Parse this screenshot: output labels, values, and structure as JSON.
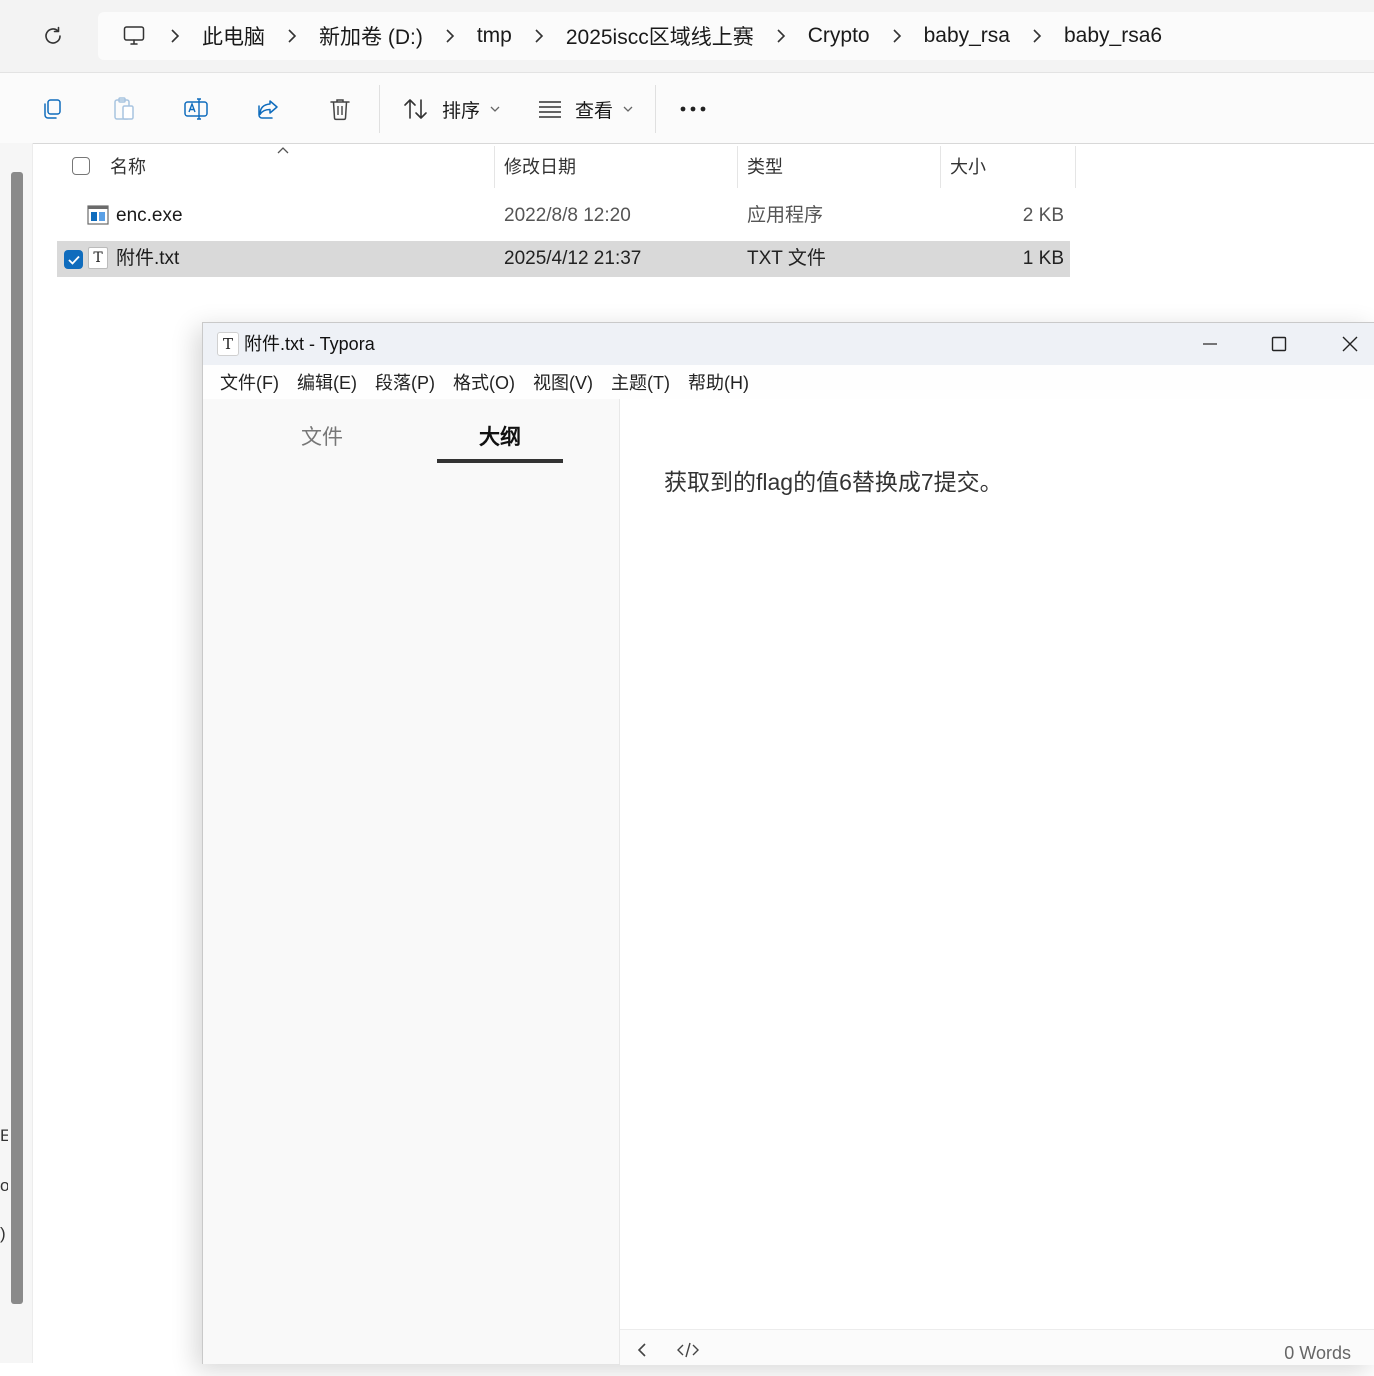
{
  "explorer": {
    "breadcrumbs": [
      "此电脑",
      "新加卷 (D:)",
      "tmp",
      "2025iscc区域线上赛",
      "Crypto",
      "baby_rsa",
      "baby_rsa6"
    ],
    "toolbar": {
      "sort_label": "排序",
      "view_label": "查看"
    },
    "columns": {
      "name": "名称",
      "modified": "修改日期",
      "type": "类型",
      "size": "大小"
    },
    "files": [
      {
        "name": "enc.exe",
        "modified": "2022/8/8 12:20",
        "type": "应用程序",
        "size": "2 KB",
        "selected": false,
        "icon": "exe-icon"
      },
      {
        "name": "附件.txt",
        "modified": "2025/4/12 21:37",
        "type": "TXT 文件",
        "size": "1 KB",
        "selected": true,
        "icon": "typora-file-icon"
      }
    ],
    "left_edge_fragments": [
      "E",
      "o",
      ")"
    ]
  },
  "typora": {
    "title": "附件.txt - Typora",
    "app_icon_glyph": "T",
    "menu": [
      "文件(F)",
      "编辑(E)",
      "段落(P)",
      "格式(O)",
      "视图(V)",
      "主题(T)",
      "帮助(H)"
    ],
    "sidebar_tabs": {
      "files": "文件",
      "outline": "大纲",
      "active": "outline"
    },
    "content": "获取到的flag的值6替换成7提交。",
    "status": {
      "word_count": "0 Words"
    }
  },
  "colors": {
    "accent": "#0f6cbd",
    "selection": "#d9d9d9",
    "titlebar": "#eef1f6"
  }
}
